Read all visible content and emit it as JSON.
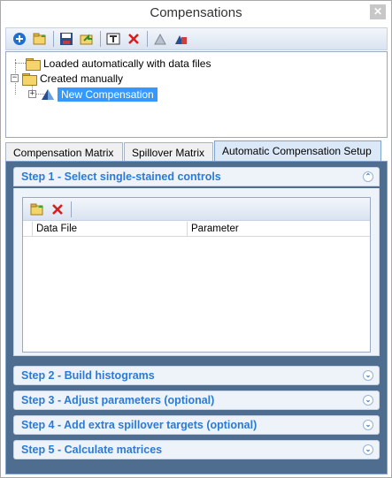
{
  "window": {
    "title": "Compensations",
    "close_label": "✕"
  },
  "toolbar": {
    "buttons": [
      "add-icon",
      "open-folder-icon",
      "save-icon",
      "export-icon",
      "rename-icon",
      "delete-icon",
      "copy-icon",
      "paste-icon"
    ]
  },
  "tree": {
    "items": [
      {
        "label": "Loaded automatically with data files"
      },
      {
        "label": "Created manually"
      },
      {
        "label": "New Compensation",
        "selected": true
      }
    ],
    "expander_plus": "+",
    "expander_minus": "−"
  },
  "tabs": [
    {
      "label": "Compensation Matrix"
    },
    {
      "label": "Spillover Matrix"
    },
    {
      "label": "Automatic Compensation Setup",
      "active": true
    }
  ],
  "steps": [
    {
      "label": "Step 1 - Select single-stained controls",
      "expanded": true
    },
    {
      "label": "Step 2 - Build histograms"
    },
    {
      "label": "Step 3 - Adjust parameters (optional)"
    },
    {
      "label": "Step 4 - Add extra spillover targets (optional)"
    },
    {
      "label": "Step 5 - Calculate matrices"
    }
  ],
  "chevrons": {
    "up": "⌃",
    "down": "⌄"
  },
  "controls_grid": {
    "columns": [
      "Data File",
      "Parameter"
    ],
    "rows": []
  },
  "colors": {
    "accent": "#2b7bd6",
    "panel_bg": "#4f6d8f",
    "selection": "#3399ff"
  }
}
